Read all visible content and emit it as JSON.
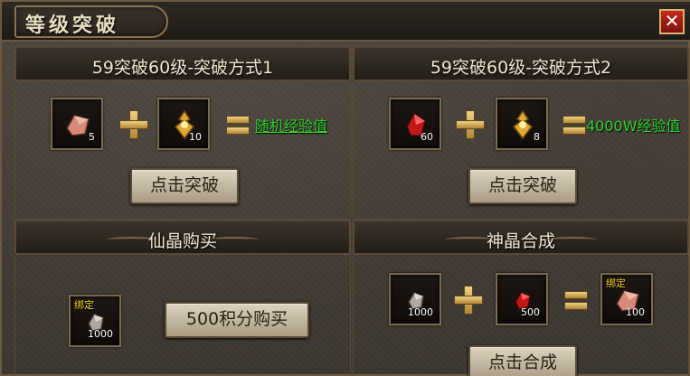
{
  "window": {
    "title": "等级突破",
    "close_label": "✕"
  },
  "panels": {
    "breakthrough1": {
      "title": "59突破60级-突破方式1",
      "item1_qty": "5",
      "item2_qty": "10",
      "result": "随机经验值",
      "button": "点击突破"
    },
    "breakthrough2": {
      "title": "59突破60级-突破方式2",
      "item1_qty": "60",
      "item2_qty": "8",
      "result": "4000W经验值",
      "button": "点击突破"
    },
    "shop": {
      "title": "仙晶购买",
      "item_bound": "绑定",
      "item_qty": "1000",
      "button": "500积分购买"
    },
    "synthesis": {
      "title": "神晶合成",
      "item1_qty": "1000",
      "item2_qty": "500",
      "result_bound": "绑定",
      "result_qty": "100",
      "button": "点击合成"
    }
  },
  "icons": {
    "crystal_grey": "grey-crystal-icon",
    "crystal_red": "red-crystal-icon",
    "crystal_pink": "pink-crystal-icon",
    "token_gold": "gold-token-icon"
  },
  "colors": {
    "result_green": "#2ed12e",
    "bound_yellow": "#f0d020",
    "close_red": "#c42a1c"
  }
}
